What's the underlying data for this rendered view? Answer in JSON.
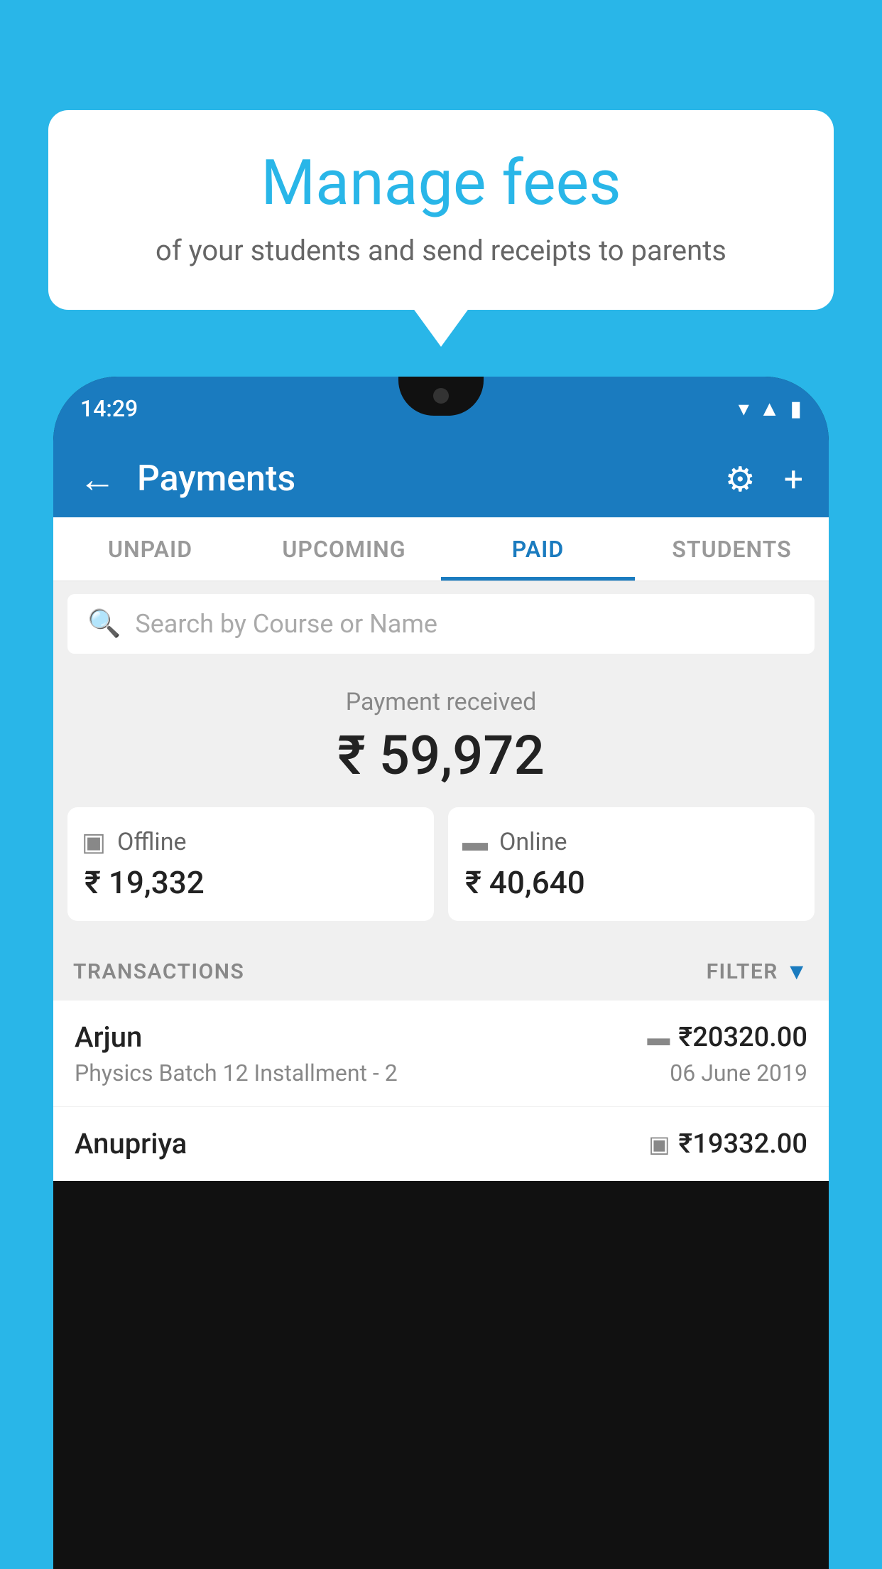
{
  "background_color": "#29b6e8",
  "bubble": {
    "title": "Manage fees",
    "subtitle": "of your students and send receipts to parents"
  },
  "phone": {
    "status_bar": {
      "time": "14:29"
    },
    "header": {
      "title": "Payments",
      "back_label": "←",
      "gear_icon": "⚙",
      "plus_icon": "+"
    },
    "tabs": [
      {
        "label": "UNPAID",
        "active": false
      },
      {
        "label": "UPCOMING",
        "active": false
      },
      {
        "label": "PAID",
        "active": true
      },
      {
        "label": "STUDENTS",
        "active": false
      }
    ],
    "search": {
      "placeholder": "Search by Course or Name"
    },
    "payment_summary": {
      "label": "Payment received",
      "total_amount": "₹ 59,972",
      "offline": {
        "label": "Offline",
        "amount": "₹ 19,332"
      },
      "online": {
        "label": "Online",
        "amount": "₹ 40,640"
      }
    },
    "transactions": {
      "header_label": "TRANSACTIONS",
      "filter_label": "FILTER",
      "items": [
        {
          "name": "Arjun",
          "course": "Physics Batch 12 Installment - 2",
          "amount": "₹20320.00",
          "date": "06 June 2019",
          "payment_type": "online"
        },
        {
          "name": "Anupriya",
          "course": "",
          "amount": "₹19332.00",
          "date": "",
          "payment_type": "offline"
        }
      ]
    }
  }
}
